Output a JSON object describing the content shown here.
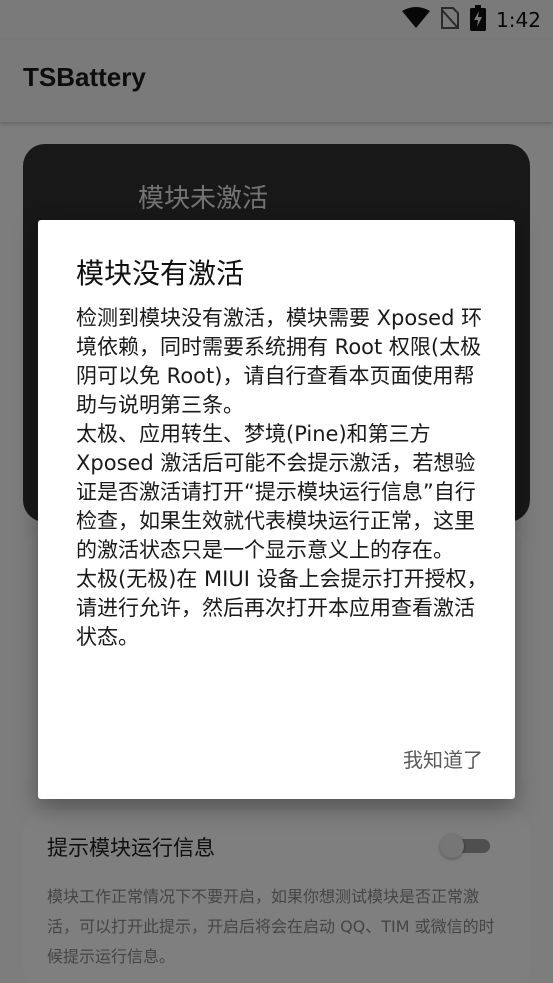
{
  "status_bar": {
    "time": "1:42",
    "icons": [
      "wifi-icon",
      "no-sim-icon",
      "battery-charging-icon"
    ]
  },
  "app_bar": {
    "title": "TSBattery"
  },
  "status_card": {
    "title": "模块未激活"
  },
  "setting_card": {
    "title": "提示模块运行信息",
    "toggle_on": false,
    "description": "模块工作正常情况下不要开启，如果你想测试模块是否正常激活，可以打开此提示，开启后将会在启动 QQ、TIM 或微信的时候提示运行信息。"
  },
  "dialog": {
    "title": "模块没有激活",
    "paragraphs": [
      "检测到模块没有激活，模块需要 Xposed 环境依赖，同时需要系统拥有 Root 权限(太极阴可以免 Root)，请自行查看本页面使用帮助与说明第三条。",
      "太极、应用转生、梦境(Pine)和第三方 Xposed 激活后可能不会提示激活，若想验证是否激活请打开“提示模块运行信息”自行检查，如果生效就代表模块运行正常，这里的激活状态只是一个显示意义上的存在。",
      "太极(无极)在 MIUI 设备上会提示打开授权，请进行允许，然后再次打开本应用查看激活状态。"
    ],
    "confirm_label": "我知道了"
  },
  "colors": {
    "scrim": "#000000",
    "dark_card": "#303030",
    "dialog_bg": "#ffffff"
  }
}
